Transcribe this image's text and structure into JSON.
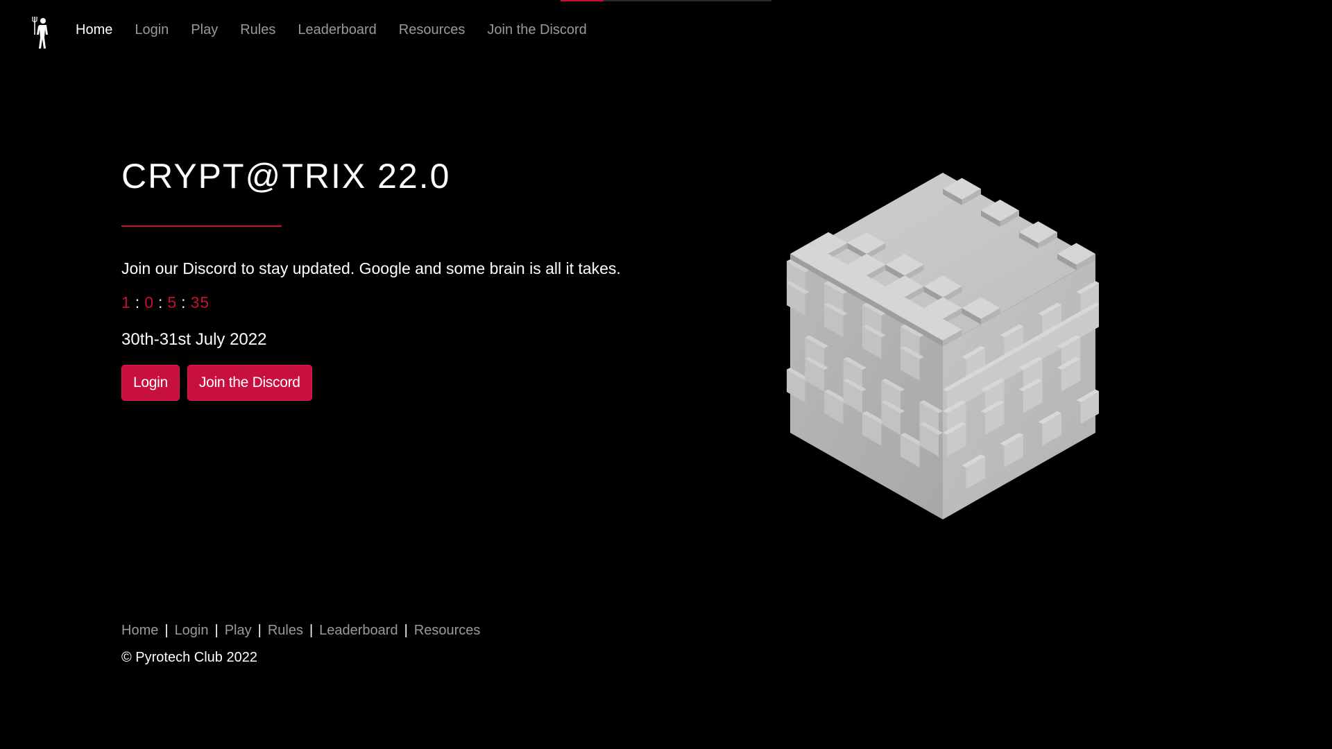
{
  "nav": {
    "logo_icon": "trident-figure-logo",
    "items": [
      {
        "label": "Home",
        "active": true
      },
      {
        "label": "Login",
        "active": false
      },
      {
        "label": "Play",
        "active": false
      },
      {
        "label": "Rules",
        "active": false
      },
      {
        "label": "Leaderboard",
        "active": false
      },
      {
        "label": "Resources",
        "active": false
      },
      {
        "label": "Join the Discord",
        "active": false
      }
    ]
  },
  "hero": {
    "title": "CRYPT@TRIX 22.0",
    "description": "Join our Discord to stay updated. Google and some brain is all it takes.",
    "countdown": {
      "days": "1",
      "hours": "0",
      "minutes": "5",
      "seconds": "35",
      "separator": ":"
    },
    "date": "30th-31st July 2022",
    "login_button": "Login",
    "discord_button": "Join the Discord",
    "visual": "voxel-cube-illustration"
  },
  "footer": {
    "links": [
      "Home",
      "Login",
      "Play",
      "Rules",
      "Leaderboard",
      "Resources"
    ],
    "separator": "|",
    "copyright": "© Pyrotech Club 2022"
  },
  "colors": {
    "background": "#000000",
    "accent": "#c8102e",
    "button": "#c8103f",
    "muted_text": "#9a9a9a"
  }
}
